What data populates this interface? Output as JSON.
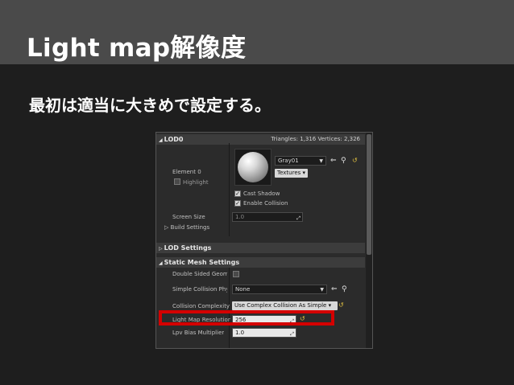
{
  "slide": {
    "title": "Light map解像度",
    "subtitle": "最初は適当に大きめで設定する。"
  },
  "panel": {
    "lod0": {
      "header": "LOD0",
      "stats": "Triangles: 1,316  Vertices: 2,326",
      "element_label": "Element 0",
      "highlight_label": "Highlight",
      "material_name": "Gray01",
      "textures_label": "Textures",
      "cast_shadow_label": "Cast Shadow",
      "enable_collision_label": "Enable Collision",
      "screen_size_label": "Screen Size",
      "screen_size_value": "1.0",
      "build_settings_label": "Build Settings"
    },
    "lod_settings": {
      "header": "LOD Settings"
    },
    "static_mesh_settings": {
      "header": "Static Mesh Settings",
      "double_sided_label": "Double Sided Geome",
      "simple_collision_label": "Simple Collision Phy",
      "simple_collision_value": "None",
      "collision_complexity_label": "Collision Complexity",
      "collision_complexity_value": "Use Complex Collision As Simple",
      "light_map_resolution_label": "Light Map Resolution",
      "light_map_resolution_value": "256",
      "lpv_bias_label": "Lpv Bias Multiplier",
      "lpv_bias_value": "1.0"
    }
  },
  "colors": {
    "highlight_border": "#d40000",
    "header_bar": "#4a4a4a",
    "background": "#1e1e1e"
  }
}
